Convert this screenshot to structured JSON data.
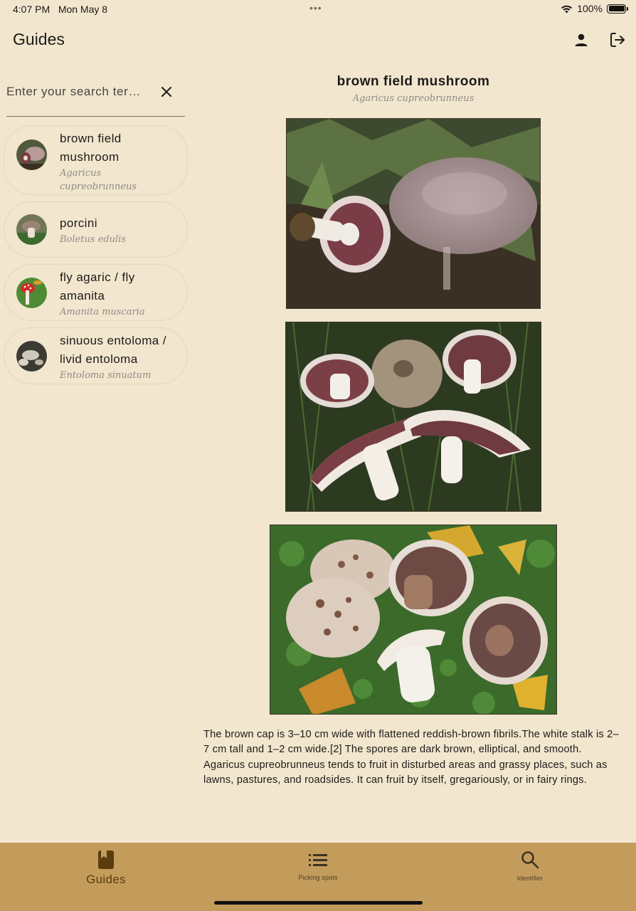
{
  "status_bar": {
    "time": "4:07 PM",
    "date": "Mon May 8",
    "dots": "•••",
    "battery": "100%"
  },
  "app_bar": {
    "title": "Guides",
    "icons": [
      "person-icon",
      "logout-icon"
    ]
  },
  "search": {
    "placeholder": "Enter your search ter…",
    "value": ""
  },
  "guides": [
    {
      "name_lines": [
        "brown field",
        "mushroom"
      ],
      "scientific_lines": [
        "Agaricus",
        "cupreobrunneus"
      ],
      "selected": true
    },
    {
      "name_lines": [
        "porcini"
      ],
      "scientific_lines": [
        "Boletus edulis"
      ],
      "selected": false
    },
    {
      "name_lines": [
        "fly agaric / fly",
        "amanita"
      ],
      "scientific_lines": [
        "Amanita muscaria"
      ],
      "selected": false
    },
    {
      "name_lines": [
        "sinuous entoloma /",
        "livid entoloma"
      ],
      "scientific_lines": [
        "Entoloma sinuatum"
      ],
      "selected": false
    }
  ],
  "detail": {
    "title": "brown field mushroom",
    "scientific": "Agaricus cupreobrunneus",
    "description": "The brown cap is 3–10 cm  wide with flattened reddish-brown fibrils.The white stalk is 2–7 cm tall and 1–2 cm wide.[2] The spores are dark brown, elliptical, and smooth. Agaricus cupreobrunneus tends to fruit in disturbed areas and grassy places, such as lawns, pastures, and roadsides. It can fruit by itself, gregariously, or in fairy rings."
  },
  "bottom_nav": {
    "items": [
      {
        "label": "Guides",
        "icon": "book-icon",
        "active": true
      },
      {
        "label": "Picking spots",
        "icon": "list-icon",
        "active": false
      },
      {
        "label": "Identifier",
        "icon": "search-icon",
        "active": false
      }
    ]
  },
  "colors": {
    "background": "#f2e6cf",
    "nav_bar": "#c39c5c",
    "nav_active": "#5a3d0d",
    "muted_text": "#8f8b83"
  }
}
